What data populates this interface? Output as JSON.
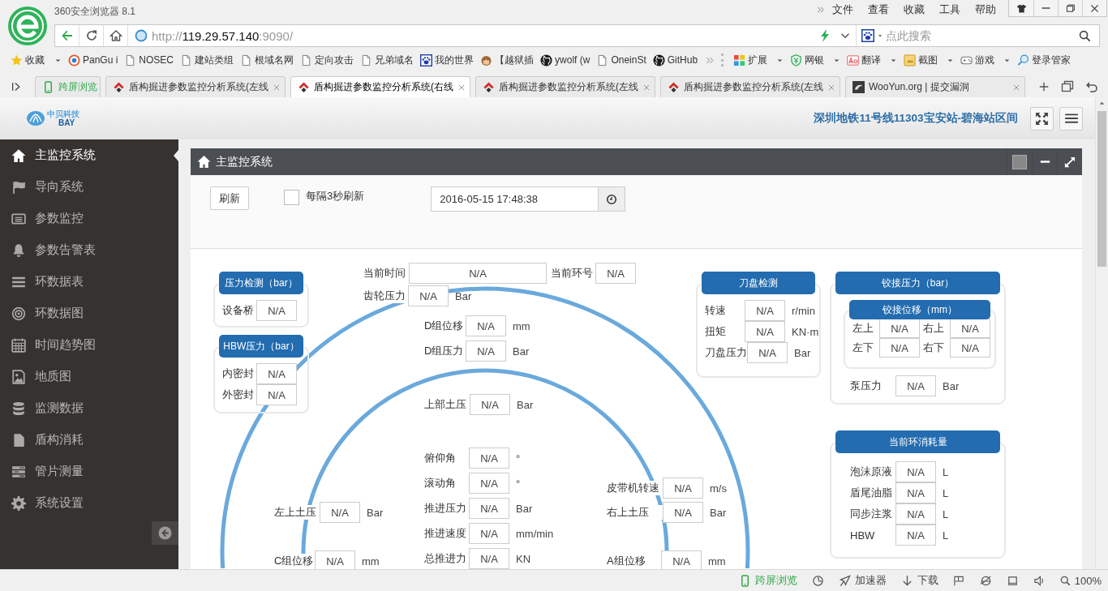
{
  "browser": {
    "title": "360安全浏览器 8.1",
    "menu": [
      "文件",
      "查看",
      "收藏",
      "工具",
      "帮助"
    ],
    "url": {
      "scheme": "http://",
      "host": "119.29.57.140",
      "port": ":9090/"
    },
    "search_placeholder": "点此搜索",
    "favorites": "收藏",
    "bookmarks": [
      "PanGu i",
      "NOSEC",
      "建站类组",
      "根域名网",
      "定向攻击",
      "兄弟域名",
      "我的世界",
      "【越狱插",
      "ywolf (w",
      "OneinSt",
      "GitHub"
    ],
    "tools": [
      {
        "label": "扩展",
        "dropdown": true
      },
      {
        "label": "网银",
        "dropdown": true
      },
      {
        "label": "翻译",
        "dropdown": true
      },
      {
        "label": "截图",
        "dropdown": true
      },
      {
        "label": "游戏",
        "dropdown": true
      },
      {
        "label": "登录管家",
        "dropdown": false
      }
    ],
    "tabs": [
      {
        "label": "跨屏浏览",
        "selected": false
      },
      {
        "label": "盾构掘进参数监控分析系统(左线",
        "selected": false
      },
      {
        "label": "盾构掘进参数监控分析系统(右线",
        "selected": true
      },
      {
        "label": "盾构掘进参数监控分析系统(左线",
        "selected": false
      },
      {
        "label": "盾构掘进参数监控分析系统(左线",
        "selected": false
      },
      {
        "label": "WooYun.org | 提交漏洞",
        "selected": false
      }
    ]
  },
  "header": {
    "logo_name": "中贝科技",
    "logo_mark": "BAY",
    "title": "深圳地铁11号线11303宝安站-碧海站区间"
  },
  "sidebar": {
    "items": [
      {
        "label": "主监控系统",
        "selected": true
      },
      {
        "label": "导向系统",
        "selected": false
      },
      {
        "label": "参数监控",
        "selected": false
      },
      {
        "label": "参数告警表",
        "selected": false
      },
      {
        "label": "环数据表",
        "selected": false
      },
      {
        "label": "环数据图",
        "selected": false
      },
      {
        "label": "时间趋势图",
        "selected": false
      },
      {
        "label": "地质图",
        "selected": false
      },
      {
        "label": "监测数据",
        "selected": false
      },
      {
        "label": "盾构消耗",
        "selected": false
      },
      {
        "label": "管片测量",
        "selected": false
      },
      {
        "label": "系统设置",
        "selected": false
      }
    ]
  },
  "panel": {
    "title": "主监控系统",
    "refresh_button": "刷新",
    "auto_refresh": {
      "label": "每隔3秒刷新",
      "checked": false
    },
    "datetime": "2016-05-15 17:48:38"
  },
  "diagram": {
    "fields": [
      {
        "label": "当前时间",
        "value": "N/A"
      },
      {
        "label": "当前环号",
        "value": "N/A"
      },
      {
        "label": "齿轮压力",
        "value": "N/A",
        "unit": "Bar"
      },
      {
        "label": "D组位移",
        "value": "N/A",
        "unit": "mm"
      },
      {
        "label": "D组压力",
        "value": "N/A",
        "unit": "Bar"
      },
      {
        "label": "上部土压",
        "value": "N/A",
        "unit": "Bar"
      },
      {
        "label": "俯仰角",
        "value": "N/A",
        "unit": "°"
      },
      {
        "label": "滚动角",
        "value": "N/A",
        "unit": "°"
      },
      {
        "label": "推进压力",
        "value": "N/A",
        "unit": "Bar"
      },
      {
        "label": "推进速度",
        "value": "N/A",
        "unit": "mm/min"
      },
      {
        "label": "总推进力",
        "value": "N/A",
        "unit": "KN"
      },
      {
        "label": "左上土压",
        "value": "N/A",
        "unit": "Bar"
      },
      {
        "label": "C组位移",
        "value": "N/A",
        "unit": "mm"
      },
      {
        "label": "皮带机转速",
        "value": "N/A",
        "unit": "m/s"
      },
      {
        "label": "右上土压",
        "value": "N/A",
        "unit": "Bar"
      },
      {
        "label": "A组位移",
        "value": "N/A",
        "unit": "mm"
      }
    ],
    "groups": [
      {
        "title": "压力检测（bar）",
        "rows": [
          {
            "label": "设备桥",
            "value": "N/A"
          }
        ]
      },
      {
        "title": "HBW压力（bar）",
        "rows": [
          {
            "label": "内密封",
            "value": "N/A"
          },
          {
            "label": "外密封",
            "value": "N/A"
          }
        ]
      },
      {
        "title": "刀盘检测",
        "rows": [
          {
            "label": "转速",
            "value": "N/A",
            "unit": "r/min"
          },
          {
            "label": "扭矩",
            "value": "N/A",
            "unit": "KN·m"
          },
          {
            "label": "刀盘压力",
            "value": "N/A",
            "unit": "Bar"
          }
        ]
      },
      {
        "title": "铰接压力（bar）",
        "subgroup": {
          "title": "铰接位移（mm）",
          "rows": [
            {
              "label": "左上",
              "value": "N/A"
            },
            {
              "label": "右上",
              "value": "N/A"
            },
            {
              "label": "左下",
              "value": "N/A"
            },
            {
              "label": "右下",
              "value": "N/A"
            }
          ]
        },
        "rows": [
          {
            "label": "泵压力",
            "value": "N/A",
            "unit": "Bar"
          }
        ]
      },
      {
        "title": "当前环消耗量",
        "rows": [
          {
            "label": "泡沫原液",
            "value": "N/A",
            "unit": "L"
          },
          {
            "label": "盾尾油脂",
            "value": "N/A",
            "unit": "L"
          },
          {
            "label": "同步注浆",
            "value": "N/A",
            "unit": "L"
          },
          {
            "label": "HBW",
            "value": "N/A",
            "unit": "L"
          }
        ]
      }
    ]
  },
  "status_bar": {
    "items": [
      "跨屏浏览",
      "加速器",
      "下载"
    ],
    "zoom": "100%"
  }
}
